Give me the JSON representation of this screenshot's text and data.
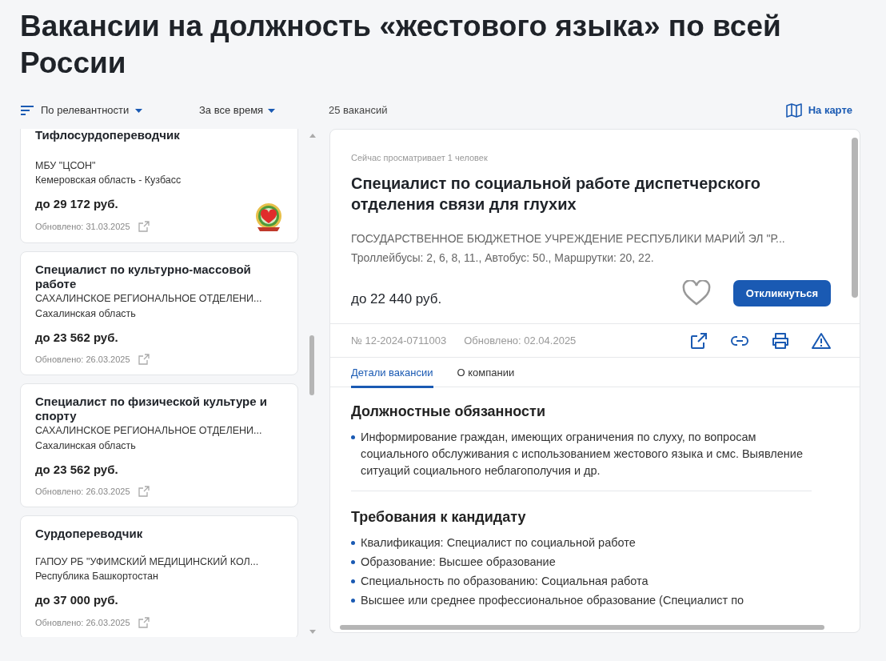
{
  "page_title": "Вакансии на должность «жестового языка» по всей России",
  "toolbar": {
    "sort": "По релевантности",
    "period": "За все время",
    "count": "25 вакансий",
    "map_link": "На карте"
  },
  "vacancy_list": [
    {
      "title": "Тифлосурдопереводчик",
      "employer": "МБУ \"ЦСОН\"",
      "region": "Кемеровская область - Кузбасс",
      "salary": "до 29 172 руб.",
      "updated": "Обновлено: 31.03.2025",
      "emblem": true
    },
    {
      "title": "Специалист по культурно-массовой работе",
      "employer": "САХАЛИНСКОЕ РЕГИОНАЛЬНОЕ ОТДЕЛЕНИ...",
      "region": "Сахалинская область",
      "salary": "до 23 562 руб.",
      "updated": "Обновлено: 26.03.2025",
      "emblem": false
    },
    {
      "title": "Специалист по физической культуре и спорту",
      "employer": "САХАЛИНСКОЕ РЕГИОНАЛЬНОЕ ОТДЕЛЕНИ...",
      "region": "Сахалинская область",
      "salary": "до 23 562 руб.",
      "updated": "Обновлено: 26.03.2025",
      "emblem": false
    },
    {
      "title": "Сурдопереводчик",
      "employer": "ГАПОУ РБ \"УФИМСКИЙ МЕДИЦИНСКИЙ КОЛ...",
      "region": "Республика Башкортостан",
      "salary": "до 37 000 руб.",
      "updated": "Обновлено: 26.03.2025",
      "emblem": false
    }
  ],
  "detail": {
    "viewers": "Сейчас просматривает 1 человек",
    "title": "Специалист по социальной работе диспетчерского отделения связи для глухих",
    "employer": "ГОСУДАРСТВЕННОЕ БЮДЖЕТНОЕ УЧРЕЖДЕНИЕ РЕСПУБЛИКИ МАРИЙ ЭЛ \"Р...",
    "transport": "Троллейбусы: 2, 6, 8, 11., Автобус: 50., Маршрутки: 20, 22.",
    "salary": "до 22 440 руб.",
    "apply_button": "Откликнуться",
    "number": "№ 12-2024-0711003",
    "updated": "Обновлено: 02.04.2025",
    "tabs": [
      {
        "label": "Детали вакансии",
        "selected": true
      },
      {
        "label": "О компании",
        "selected": false
      }
    ],
    "sections": [
      {
        "heading": "Должностные обязанности",
        "items": [
          "Информирование граждан, имеющих ограничения по слуху, по вопросам социального обслуживания с использованием жестового языка и смс. Выявление ситуаций социального неблагополучия и др."
        ]
      },
      {
        "heading": "Требования к кандидату",
        "items": [
          "Квалификация: Специалист по социальной работе",
          "Образование: Высшее образование",
          "Специальность по образованию: Социальная работа",
          "Высшее или среднее профессиональное образование (Специалист по"
        ]
      }
    ]
  }
}
